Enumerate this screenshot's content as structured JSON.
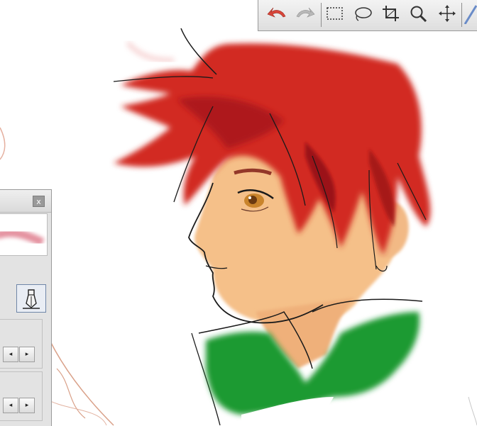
{
  "toolbar": {
    "tools": [
      {
        "icon": "undo-arrow-icon",
        "tooltip": ""
      },
      {
        "icon": "redo-arrow-icon",
        "tooltip": ""
      },
      {
        "icon": "rectangle-select-icon",
        "tooltip": ""
      },
      {
        "icon": "lasso-select-icon",
        "tooltip": ""
      },
      {
        "icon": "crop-icon",
        "tooltip": ""
      },
      {
        "icon": "zoom-magnifier-icon",
        "tooltip": ""
      },
      {
        "icon": "move-arrows-icon",
        "tooltip": ""
      },
      {
        "icon": "pen-icon",
        "tooltip": ""
      }
    ],
    "accent_undo": "#d9463a",
    "disabled_gray": "#9a9a9a"
  },
  "brush_panel": {
    "close_label": "x",
    "stroke_preview_color": "#e08090",
    "pen_tip_icon": "pen-nib-icon",
    "spinner_left": "◂",
    "spinner_right": "▸"
  },
  "canvas": {
    "hair_color": "#d22a20",
    "jacket_color": "#1e9a32",
    "skin_color": "#f5c089",
    "line_color": "#1a1a1a"
  }
}
